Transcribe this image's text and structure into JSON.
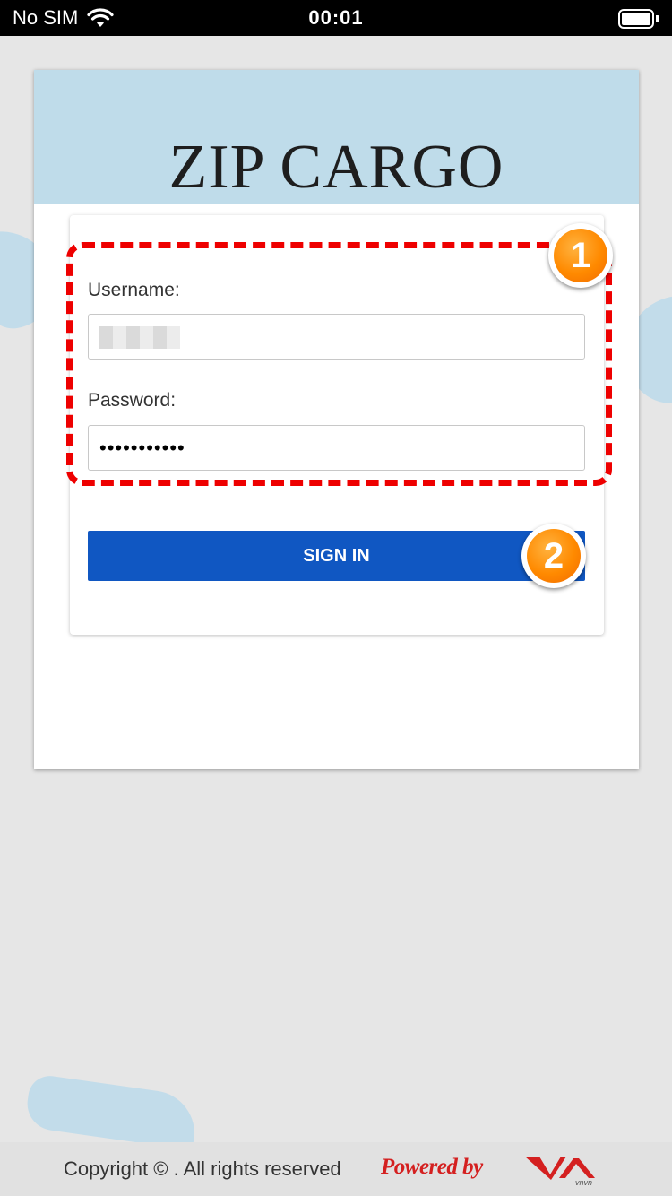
{
  "status_bar": {
    "carrier": "No SIM",
    "time": "00:01",
    "icons": [
      "wifi-icon",
      "battery-icon"
    ]
  },
  "header": {
    "brand": "ZIP CARGO",
    "background_color": "#bfdcea"
  },
  "login_form": {
    "username_label": "Username:",
    "password_label": "Password:",
    "password_value": "•••••••••••",
    "sign_in_label": "SIGN IN",
    "button_color": "#1057c2"
  },
  "annotations": {
    "step_1": "1",
    "step_2": "2",
    "highlight_color": "#ee0000",
    "badge_color": "#ff8a00"
  },
  "footer": {
    "copyright": "Copyright © . All rights reserved",
    "powered_by": "Powered by",
    "logo_name": "vnvn-logo",
    "logo_text": "vnvn"
  }
}
